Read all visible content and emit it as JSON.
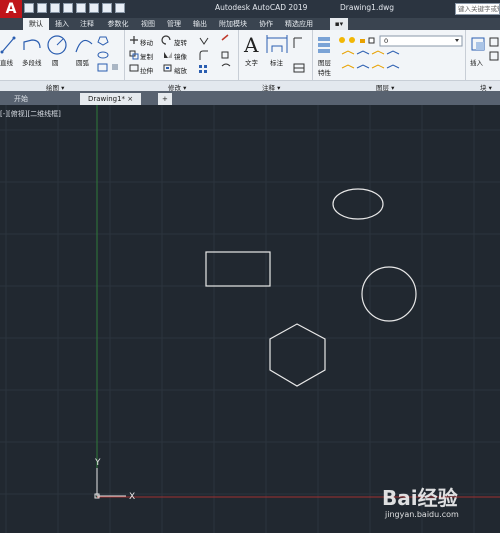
{
  "app": {
    "title": "Autodesk AutoCAD 2019",
    "file": "Drawing1.dwg",
    "search_placeholder": "键入关键字或短语",
    "menu_icon": "autocad-a-logo"
  },
  "ribbon_tabs": [
    "默认",
    "插入",
    "注释",
    "参数化",
    "视图",
    "管理",
    "输出",
    "附加模块",
    "协作",
    "精选应用"
  ],
  "ribbon": {
    "draw": {
      "line": "直线",
      "polyline": "多段线",
      "circle": "圆",
      "arc": "圆弧",
      "panel": "绘图"
    },
    "modify": {
      "move": "移动",
      "rotate": "旋转",
      "copy": "复制",
      "mirror": "镜像",
      "stretch": "拉伸",
      "scale": "缩放",
      "panel": "修改"
    },
    "annotation": {
      "text": "文字",
      "dimension": "标注",
      "panel": "注释"
    },
    "layers": {
      "properties": "图层",
      "properties2": "特性",
      "current": "0",
      "panel": "图层"
    },
    "block": {
      "insert": "插入",
      "panel": "块"
    }
  },
  "doc_tabs": {
    "start": "开始",
    "drawing": "Drawing1*",
    "add": "+"
  },
  "viewport_label": "[-][俯视][二维线框]",
  "ucs": {
    "x": "X",
    "y": "Y"
  },
  "watermark": {
    "main": "Bai经验",
    "sub": "jingyan.baidu.com"
  },
  "colors": {
    "canvas": "#212830",
    "grid": "#2c343e",
    "ucs_x": "#a03030",
    "ucs_y": "#2e7a3a",
    "shapes": "#e8e8e8"
  }
}
